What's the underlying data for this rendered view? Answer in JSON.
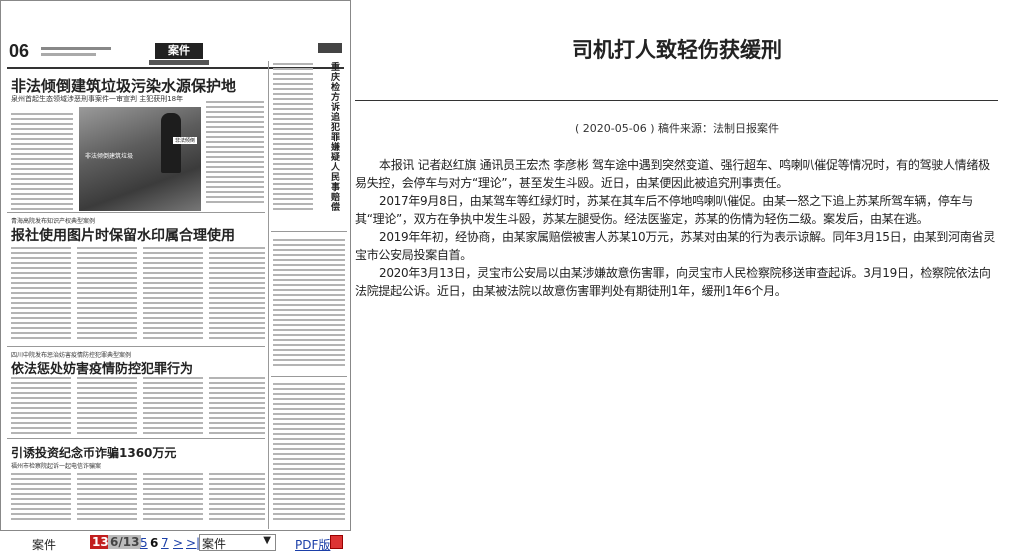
{
  "article": {
    "title": "司机打人致轻伤获缓刑",
    "byline": "( 2020-05-06 )  稿件来源：法制日报案件",
    "paragraphs": [
      "本报讯 记者赵红旗 通讯员王宏杰 李彦彬 驾车途中遇到突然变道、强行超车、鸣喇叭催促等情况时，有的驾驶人情绪极易失控，会停车与对方“理论”，甚至发生斗殴。近日，由某便因此被追究刑事责任。",
      "2017年9月8日，由某驾车等红绿灯时，苏某在其车后不停地鸣喇叭催促。由某一怒之下追上苏某所驾车辆，停车与其“理论”，双方在争执中发生斗殴，苏某左腿受伤。经法医鉴定，苏某的伤情为轻伤二级。案发后，由某在逃。",
      "2019年年初，经协商，由某家属赔偿被害人苏某10万元，苏某对由某的行为表示谅解。同年3月15日，由某到河南省灵宝市公安局投案自首。",
      "2020年3月13日，灵宝市公安局以由某涉嫌故意伤害罪，向灵宝市人民检察院移送审查起诉。3月19日，检察院依法向法院提起公诉。近日，由某被法院以故意伤害罪判处有期徒刑1年，缓刑1年6个月。"
    ]
  },
  "newspaper": {
    "page_number": "06",
    "masthead_logo": "案件",
    "photo_caption": "非法倾倒建筑垃圾",
    "photo_tag": "非法倾倒",
    "headline_1": "非法倾倒建筑垃圾污染水源保护地",
    "headline_1_sub": "泉州首起生态领域涉恶刑事案件一审宣判 主犯获刑18年",
    "headline_2_kicker": "青海高院发布知识产权典型案例",
    "headline_2": "报社使用图片时保留水印属合理使用",
    "headline_3_kicker": "四川中院发布惩治妨害疫情防控犯罪典型案例",
    "headline_3": "依法惩处妨害疫情防控犯罪行为",
    "headline_4": "引诱投资纪念币诈骗1360万元",
    "headline_4_sub": "福州市检察院起诉一起电信诈骗案",
    "vertical_headline": "重庆检方诉追犯罪嫌疑人民事赔偿"
  },
  "nav": {
    "section_label": "案件",
    "current_page": "13",
    "page_of_total": "6/13",
    "prev_page": "5",
    "this_page": "6",
    "next_page_num": "7",
    "next_arrow": ">",
    "last_arrow": ">|",
    "section_select_value": "案件",
    "select_arrow": "▼",
    "pdf_label": "PDF版"
  }
}
